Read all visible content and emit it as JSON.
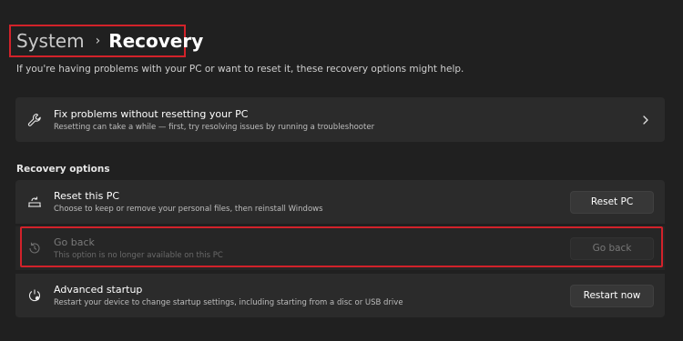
{
  "breadcrumb": {
    "parent": "System",
    "separator": "›",
    "current": "Recovery"
  },
  "page_description": "If you're having problems with your PC or want to reset it, these recovery options might help.",
  "fix_problems": {
    "title": "Fix problems without resetting your PC",
    "subtitle": "Resetting can take a while — first, try resolving issues by running a troubleshooter",
    "icon": "wrench-icon"
  },
  "recovery_options": {
    "heading": "Recovery options",
    "items": [
      {
        "title": "Reset this PC",
        "subtitle": "Choose to keep or remove your personal files, then reinstall Windows",
        "button": "Reset PC",
        "icon": "reset-pc-icon",
        "enabled": true
      },
      {
        "title": "Go back",
        "subtitle": "This option is no longer available on this PC",
        "button": "Go back",
        "icon": "history-icon",
        "enabled": false
      },
      {
        "title": "Advanced startup",
        "subtitle": "Restart your device to change startup settings, including starting from a disc or USB drive",
        "button": "Restart now",
        "icon": "advanced-startup-icon",
        "enabled": true
      }
    ]
  },
  "colors": {
    "background": "#202020",
    "card": "#2b2b2b",
    "highlight_border": "#d2222a"
  }
}
